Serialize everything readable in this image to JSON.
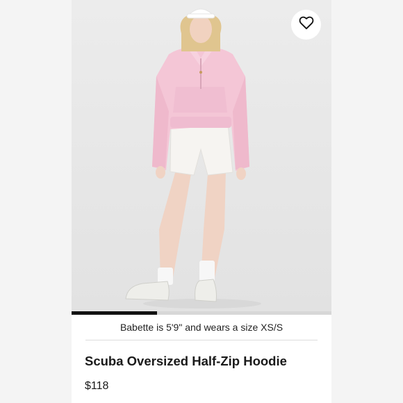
{
  "product": {
    "fit_note": "Babette is 5'9\" and wears a size XS/S",
    "title": "Scuba Oversized Half-Zip Hoodie",
    "price": "$118"
  },
  "gallery": {
    "progress": 0.33
  },
  "icons": {
    "favorite": "heart-outline-icon"
  },
  "colors": {
    "hoodie": "#f4c6d6",
    "background": "#e8e8e8",
    "progress": "#111111"
  }
}
